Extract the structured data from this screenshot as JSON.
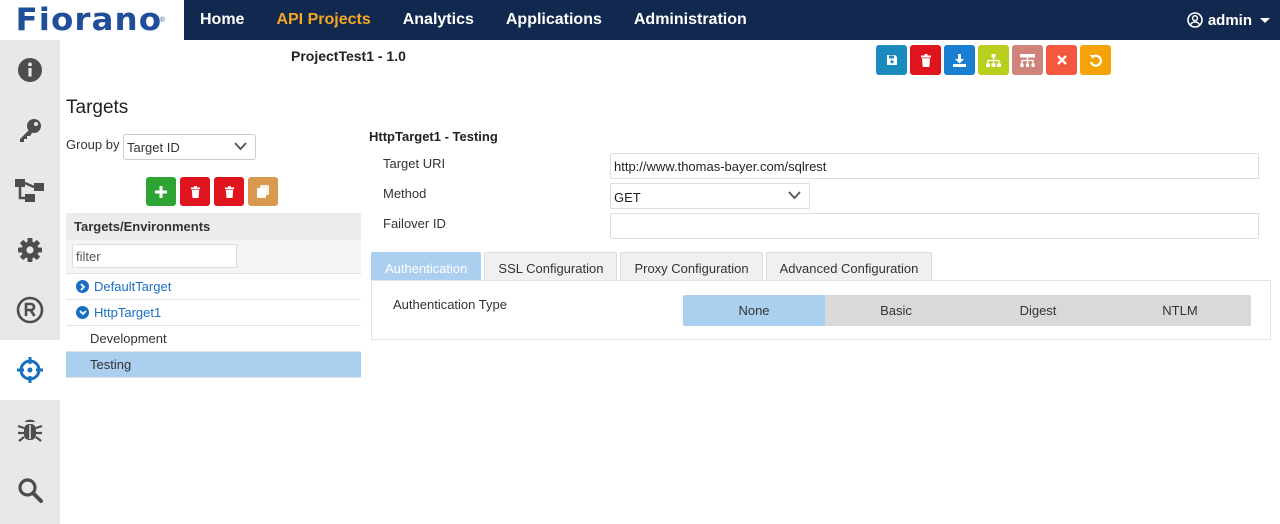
{
  "brand": {
    "logo_text": "Fiorano",
    "registered": "®",
    "color": "#1f4f9a"
  },
  "nav": {
    "items": [
      {
        "label": "Home",
        "active": false
      },
      {
        "label": "API Projects",
        "active": true
      },
      {
        "label": "Analytics",
        "active": false
      },
      {
        "label": "Applications",
        "active": false
      },
      {
        "label": "Administration",
        "active": false
      }
    ],
    "user": "admin",
    "active_color": "#f5a623",
    "bar_color": "#12294f"
  },
  "sidebar": {
    "items": [
      {
        "icon": "info-icon"
      },
      {
        "icon": "key-icon"
      },
      {
        "icon": "flow-icon"
      },
      {
        "icon": "gear-icon"
      },
      {
        "icon": "registered-icon"
      },
      {
        "icon": "crosshair-icon",
        "active": true
      },
      {
        "icon": "bug-icon"
      },
      {
        "icon": "search-icon"
      }
    ]
  },
  "project": {
    "title": "ProjectTest1 - 1.0"
  },
  "toolbar": {
    "buttons": [
      {
        "icon": "save-icon",
        "color": "#1b8bbd"
      },
      {
        "icon": "delete-icon",
        "color": "#e0141e"
      },
      {
        "icon": "download-icon",
        "color": "#1a7fd1"
      },
      {
        "icon": "hierarchy-icon",
        "color": "#b9cf1b"
      },
      {
        "icon": "structure-icon",
        "color": "#d0837a"
      },
      {
        "icon": "close-icon",
        "color": "#f4583e"
      },
      {
        "icon": "undo-icon",
        "color": "#f5a30a"
      }
    ]
  },
  "targets": {
    "heading": "Targets",
    "group_by_label": "Group by",
    "group_by_value": "Target ID",
    "actions": [
      {
        "icon": "add-icon",
        "color": "#2ea532"
      },
      {
        "icon": "delete-icon",
        "color": "#e0141e"
      },
      {
        "icon": "delete-all-icon",
        "color": "#e0141e"
      },
      {
        "icon": "copy-icon",
        "color": "#d99a4f"
      }
    ],
    "tree_header": "Targets/Environments",
    "filter_placeholder": "filter",
    "tree": [
      {
        "label": "DefaultTarget",
        "kind": "parent",
        "expanded": false
      },
      {
        "label": "HttpTarget1",
        "kind": "parent",
        "expanded": true
      },
      {
        "label": "Development",
        "kind": "child",
        "selected": false
      },
      {
        "label": "Testing",
        "kind": "child",
        "selected": true
      }
    ]
  },
  "detail": {
    "title": "HttpTarget1 - Testing",
    "target_uri_label": "Target URI",
    "target_uri_value": "http://www.thomas-bayer.com/sqlrest",
    "method_label": "Method",
    "method_value": "GET",
    "failover_label": "Failover ID",
    "failover_value": ""
  },
  "tabs": [
    {
      "label": "Authentication",
      "active": true
    },
    {
      "label": "SSL Configuration",
      "active": false
    },
    {
      "label": "Proxy Configuration",
      "active": false
    },
    {
      "label": "Advanced Configuration",
      "active": false
    }
  ],
  "auth": {
    "label": "Authentication Type",
    "options": [
      {
        "label": "None",
        "active": true
      },
      {
        "label": "Basic",
        "active": false
      },
      {
        "label": "Digest",
        "active": false
      },
      {
        "label": "NTLM",
        "active": false
      }
    ],
    "selected_color": "#abd0ef"
  }
}
